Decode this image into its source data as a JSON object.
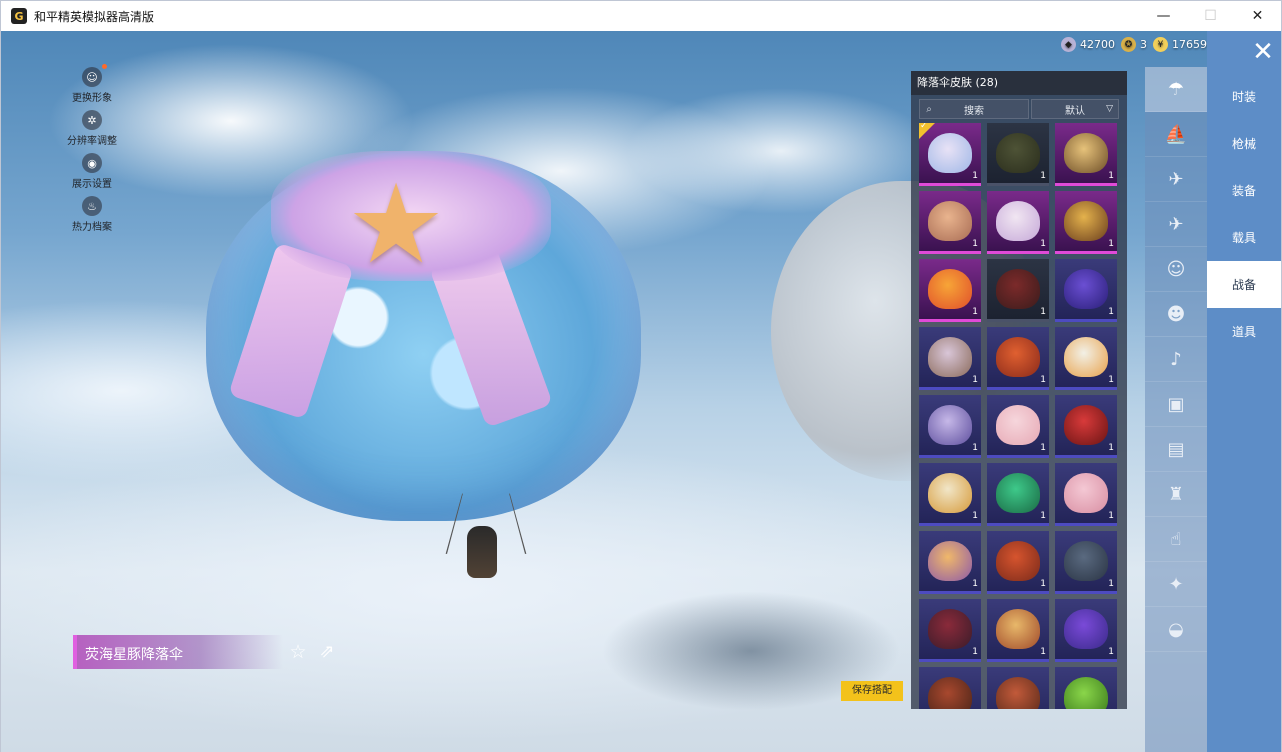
{
  "window": {
    "title": "和平精英模拟器高清版",
    "icon_letter": "G",
    "controls": {
      "minimize": "—",
      "maximize": "☐",
      "close": "✕"
    }
  },
  "left_menu": [
    {
      "icon": "person-icon",
      "glyph": "☺",
      "label": "更换形象",
      "has_dot": true
    },
    {
      "icon": "gear-icon",
      "glyph": "✲",
      "label": "分辨率调整"
    },
    {
      "icon": "eye-icon",
      "glyph": "◉",
      "label": "展示设置"
    },
    {
      "icon": "fire-icon",
      "glyph": "♨",
      "label": "热力档案"
    }
  ],
  "currency": [
    {
      "icon": "silver-coin-icon",
      "value": "42700",
      "color": "#b8b2d6"
    },
    {
      "icon": "token-icon",
      "value": "3",
      "color": "#d9b14a"
    },
    {
      "icon": "gold-coin-icon",
      "value": "17659",
      "color": "#f2cf5a"
    }
  ],
  "item_name": "荧海星豚降落伞",
  "actions": {
    "favorite_glyph": "☆",
    "share_glyph": "⇗",
    "save_label": "保存搭配"
  },
  "panel": {
    "title": "降落伞皮肤 (28)",
    "search_placeholder": "搜索",
    "sort_value": "默认",
    "items": [
      {
        "rarity": "pink",
        "colors": [
          "#e8e2f6",
          "#9fb7e6"
        ],
        "count": "1",
        "equipped": true
      },
      {
        "rarity": "dark",
        "colors": [
          "#4e5336",
          "#2a2d1c"
        ],
        "count": "1"
      },
      {
        "rarity": "pink",
        "colors": [
          "#e6c27a",
          "#6d4e28"
        ],
        "count": "1"
      },
      {
        "rarity": "pink",
        "colors": [
          "#e9b48e",
          "#a86c54"
        ],
        "count": "1"
      },
      {
        "rarity": "pink",
        "colors": [
          "#f1e6f2",
          "#c5a8d8"
        ],
        "count": "1"
      },
      {
        "rarity": "pink",
        "colors": [
          "#e4b24c",
          "#6a3e1e"
        ],
        "count": "1"
      },
      {
        "rarity": "pink",
        "colors": [
          "#f7a537",
          "#e04f2a"
        ],
        "count": "1"
      },
      {
        "rarity": "dark",
        "colors": [
          "#7c2a2a",
          "#3a1c1c"
        ],
        "count": "1"
      },
      {
        "rarity": "blue",
        "colors": [
          "#6b4fd3",
          "#2a1f78"
        ],
        "count": "1"
      },
      {
        "rarity": "blue",
        "colors": [
          "#d9c6d8",
          "#8a6a5a"
        ],
        "count": "1"
      },
      {
        "rarity": "blue",
        "colors": [
          "#e06030",
          "#8a2a1a"
        ],
        "count": "1"
      },
      {
        "rarity": "blue",
        "colors": [
          "#f2f0e6",
          "#e8a14a"
        ],
        "count": "1"
      },
      {
        "rarity": "blue",
        "colors": [
          "#c6b8e8",
          "#5e4f9e"
        ],
        "count": "1"
      },
      {
        "rarity": "blue",
        "colors": [
          "#f6d6dc",
          "#e6a8b4"
        ],
        "count": "1"
      },
      {
        "rarity": "blue",
        "colors": [
          "#d83a3a",
          "#6a1414"
        ],
        "count": "1"
      },
      {
        "rarity": "blue",
        "colors": [
          "#f1e6c8",
          "#d69a3a"
        ],
        "count": "1"
      },
      {
        "rarity": "blue",
        "colors": [
          "#3ec98a",
          "#1a6a44"
        ],
        "count": "1"
      },
      {
        "rarity": "blue",
        "colors": [
          "#f4c8d4",
          "#d88ea2"
        ],
        "count": "1"
      },
      {
        "rarity": "blue",
        "colors": [
          "#f0b86a",
          "#8e5aa8"
        ],
        "count": "1"
      },
      {
        "rarity": "blue",
        "colors": [
          "#d6542e",
          "#7a2a1a"
        ],
        "count": "1"
      },
      {
        "rarity": "blue",
        "colors": [
          "#5a6a80",
          "#2a3444"
        ],
        "count": "1"
      },
      {
        "rarity": "blue",
        "colors": [
          "#8a2a3a",
          "#3a1c2a"
        ],
        "count": "1"
      },
      {
        "rarity": "blue",
        "colors": [
          "#e8b86a",
          "#a04a2a"
        ],
        "count": "1"
      },
      {
        "rarity": "blue",
        "colors": [
          "#7a4ad8",
          "#3a2a8a"
        ],
        "count": "1"
      },
      {
        "rarity": "blue",
        "colors": [
          "#a8482e",
          "#4a2418"
        ],
        "count": "1"
      },
      {
        "rarity": "blue",
        "colors": [
          "#c25a3a",
          "#5a2a1a"
        ],
        "count": "1"
      },
      {
        "rarity": "blue",
        "colors": [
          "#8ad64a",
          "#3a7a1a"
        ],
        "count": "1"
      }
    ]
  },
  "categories": [
    {
      "icon": "parachute-icon",
      "glyph": "☂",
      "active": true
    },
    {
      "icon": "boat-icon",
      "glyph": "⛵"
    },
    {
      "icon": "plane-trail-icon",
      "glyph": "✈"
    },
    {
      "icon": "plane-icon",
      "glyph": "✈"
    },
    {
      "icon": "emote-icon",
      "glyph": "☺"
    },
    {
      "icon": "pet-icon",
      "glyph": "☻"
    },
    {
      "icon": "speaker-icon",
      "glyph": "♪"
    },
    {
      "icon": "chat-icon",
      "glyph": "▣"
    },
    {
      "icon": "photo-icon",
      "glyph": "▤"
    },
    {
      "icon": "spray-icon",
      "glyph": "♜"
    },
    {
      "icon": "hand-icon",
      "glyph": "☝"
    },
    {
      "icon": "sparkle-icon",
      "glyph": "✦"
    },
    {
      "icon": "dish-icon",
      "glyph": "◒"
    }
  ],
  "tabs": [
    {
      "label": "时装"
    },
    {
      "label": "枪械"
    },
    {
      "label": "装备"
    },
    {
      "label": "载具"
    },
    {
      "label": "战备",
      "active": true
    },
    {
      "label": "道具"
    }
  ],
  "close_glyph": "✕"
}
